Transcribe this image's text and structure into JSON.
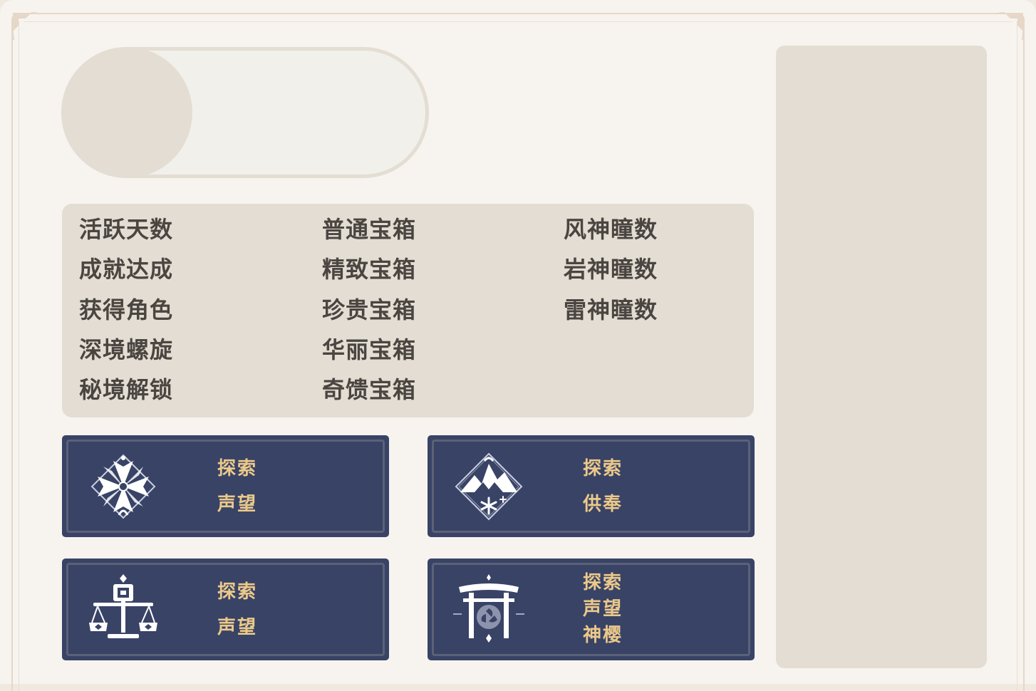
{
  "stats": {
    "col1": [
      "活跃天数",
      "成就达成",
      "获得角色",
      "深境螺旋",
      "秘境解锁"
    ],
    "col2": [
      "普通宝箱",
      "精致宝箱",
      "珍贵宝箱",
      "华丽宝箱",
      "奇馈宝箱"
    ],
    "col3": [
      "风神瞳数",
      "岩神瞳数",
      "雷神瞳数"
    ]
  },
  "regions": [
    {
      "icon": "mondstadt-emblem-icon",
      "labels": [
        "探索",
        "声望"
      ]
    },
    {
      "icon": "dragonspine-emblem-icon",
      "labels": [
        "探索",
        "供奉"
      ]
    },
    {
      "icon": "liyue-emblem-icon",
      "labels": [
        "探索",
        "声望"
      ]
    },
    {
      "icon": "inazuma-emblem-icon",
      "labels": [
        "探索",
        "声望",
        "神樱"
      ]
    }
  ],
  "colors": {
    "background": "#f7f4ef",
    "panel": "#e3ddd3",
    "card": "#384366",
    "card_text": "#ecc98a",
    "stat_text": "#4a4540"
  }
}
